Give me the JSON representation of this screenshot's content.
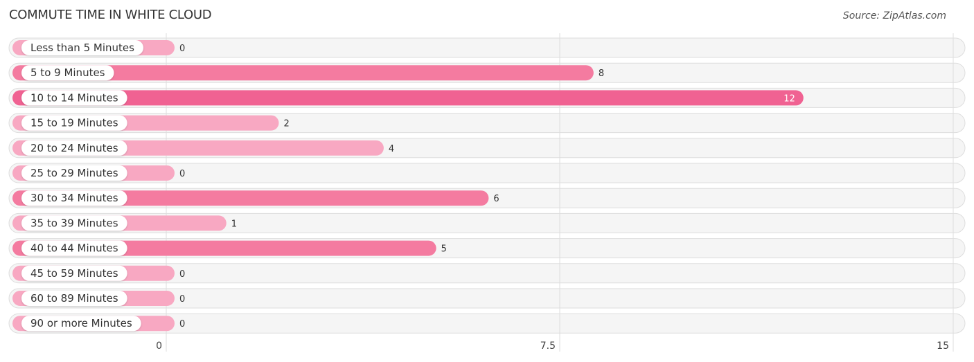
{
  "chart_data": {
    "type": "bar",
    "orientation": "horizontal",
    "title": "COMMUTE TIME IN WHITE CLOUD",
    "source": "Source: ZipAtlas.com",
    "categories": [
      "Less than 5 Minutes",
      "5 to 9 Minutes",
      "10 to 14 Minutes",
      "15 to 19 Minutes",
      "20 to 24 Minutes",
      "25 to 29 Minutes",
      "30 to 34 Minutes",
      "35 to 39 Minutes",
      "40 to 44 Minutes",
      "45 to 59 Minutes",
      "60 to 89 Minutes",
      "90 or more Minutes"
    ],
    "values": [
      0,
      8,
      12,
      2,
      4,
      0,
      6,
      1,
      5,
      0,
      0,
      0
    ],
    "xlim": [
      0,
      15
    ],
    "xticks": [
      0,
      7.5,
      15
    ],
    "xtick_labels": [
      "0",
      "7.5",
      "15"
    ],
    "xlabel": "",
    "ylabel": "",
    "grid": true,
    "legend": "none",
    "colors": {
      "bar_max": "#f06292",
      "bar_high": "#f47ba0",
      "bar_low": "#f8a8c2",
      "track": "#f5f5f5",
      "track_border": "#dddddd",
      "grid": "#dddddd",
      "label_pill": "#ffffff"
    }
  }
}
